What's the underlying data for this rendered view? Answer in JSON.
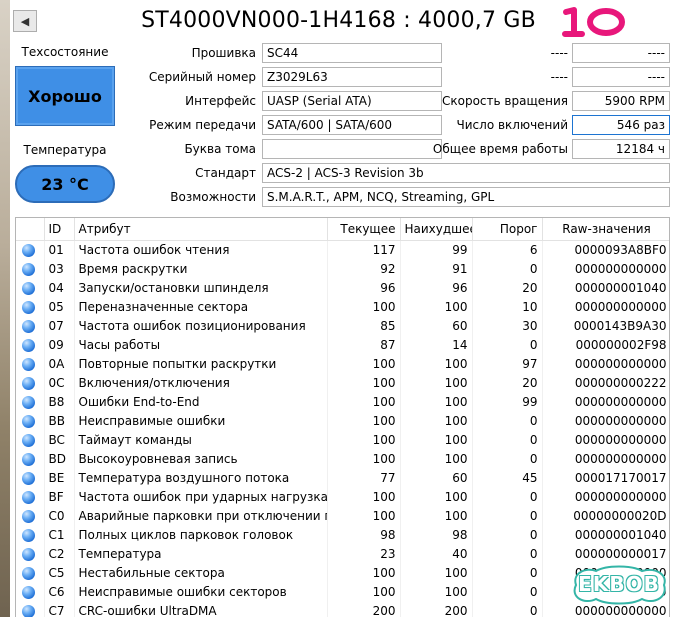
{
  "header": {
    "back_icon": "triangle-left-icon",
    "title": "ST4000VN000-1H4168 : 4000,7 GB",
    "scribble_text": "10",
    "scribble_color": "#e8177b"
  },
  "health": {
    "label": "Техсостояние",
    "status": "Хорошо",
    "color": "#3f8fe6"
  },
  "temperature": {
    "label": "Температура",
    "value": "23 °C"
  },
  "fields": {
    "firmware": {
      "label": "Прошивка",
      "value": "SC44"
    },
    "serial": {
      "label": "Серийный номер",
      "value": "Z3029L63"
    },
    "interface": {
      "label": "Интерфейс",
      "value": "UASP (Serial ATA)"
    },
    "transfer_mode": {
      "label": "Режим передачи",
      "value": "SATA/600 | SATA/600"
    },
    "drive_letter": {
      "label": "Буква тома",
      "value": ""
    },
    "standard": {
      "label": "Стандарт",
      "value": "ACS-2 | ACS-3 Revision 3b"
    },
    "features": {
      "label": "Возможности",
      "value": "S.M.A.R.T., APM, NCQ, Streaming, GPL"
    }
  },
  "right_fields": {
    "r1_label": "----",
    "r1_value": "----",
    "r2_label": "----",
    "r2_value": "----",
    "rotation": {
      "label": "Скорость вращения",
      "value": "5900 RPM"
    },
    "power_count": {
      "label": "Число включений",
      "value": "546 раз"
    },
    "power_hours": {
      "label": "Общее время работы",
      "value": "12184 ч"
    }
  },
  "table": {
    "headers": {
      "id": "ID",
      "attr": "Атрибут",
      "cur": "Текущее",
      "worst": "Наихудшее",
      "thr": "Порог",
      "raw": "Raw-значения"
    },
    "rows": [
      {
        "id": "01",
        "attr": "Частота ошибок чтения",
        "cur": "117",
        "worst": "99",
        "thr": "6",
        "raw": "0000093A8BF0"
      },
      {
        "id": "03",
        "attr": "Время раскрутки",
        "cur": "92",
        "worst": "91",
        "thr": "0",
        "raw": "000000000000"
      },
      {
        "id": "04",
        "attr": "Запуски/остановки шпинделя",
        "cur": "96",
        "worst": "96",
        "thr": "20",
        "raw": "000000001040"
      },
      {
        "id": "05",
        "attr": "Переназначенные сектора",
        "cur": "100",
        "worst": "100",
        "thr": "10",
        "raw": "000000000000"
      },
      {
        "id": "07",
        "attr": "Частота ошибок позиционирования",
        "cur": "85",
        "worst": "60",
        "thr": "30",
        "raw": "0000143B9A30"
      },
      {
        "id": "09",
        "attr": "Часы работы",
        "cur": "87",
        "worst": "14",
        "thr": "0",
        "raw": "000000002F98"
      },
      {
        "id": "0A",
        "attr": "Повторные попытки раскрутки",
        "cur": "100",
        "worst": "100",
        "thr": "97",
        "raw": "000000000000"
      },
      {
        "id": "0C",
        "attr": "Включения/отключения",
        "cur": "100",
        "worst": "100",
        "thr": "20",
        "raw": "000000000222"
      },
      {
        "id": "B8",
        "attr": "Ошибки End-to-End",
        "cur": "100",
        "worst": "100",
        "thr": "99",
        "raw": "000000000000"
      },
      {
        "id": "BB",
        "attr": "Неисправимые ошибки",
        "cur": "100",
        "worst": "100",
        "thr": "0",
        "raw": "000000000000"
      },
      {
        "id": "BC",
        "attr": "Таймаут команды",
        "cur": "100",
        "worst": "100",
        "thr": "0",
        "raw": "000000000000"
      },
      {
        "id": "BD",
        "attr": "Высокоуровневая запись",
        "cur": "100",
        "worst": "100",
        "thr": "0",
        "raw": "000000000000"
      },
      {
        "id": "BE",
        "attr": "Температура воздушного потока",
        "cur": "77",
        "worst": "60",
        "thr": "45",
        "raw": "000017170017"
      },
      {
        "id": "BF",
        "attr": "Частота ошибок при ударных нагрузках",
        "cur": "100",
        "worst": "100",
        "thr": "0",
        "raw": "000000000000"
      },
      {
        "id": "C0",
        "attr": "Аварийные парковки при отключении пи...",
        "cur": "100",
        "worst": "100",
        "thr": "0",
        "raw": "00000000020D"
      },
      {
        "id": "C1",
        "attr": "Полных циклов парковок головок",
        "cur": "98",
        "worst": "98",
        "thr": "0",
        "raw": "000000001040"
      },
      {
        "id": "C2",
        "attr": "Температура",
        "cur": "23",
        "worst": "40",
        "thr": "0",
        "raw": "000000000017"
      },
      {
        "id": "C5",
        "attr": "Нестабильные сектора",
        "cur": "100",
        "worst": "100",
        "thr": "0",
        "raw": "000000000000"
      },
      {
        "id": "C6",
        "attr": "Неисправимые ошибки секторов",
        "cur": "100",
        "worst": "100",
        "thr": "0",
        "raw": "000000000000"
      },
      {
        "id": "C7",
        "attr": "CRC-ошибки UltraDMA",
        "cur": "200",
        "worst": "200",
        "thr": "0",
        "raw": "000000000000"
      }
    ],
    "status_icon": "blue-circle-icon"
  },
  "watermark": {
    "text": "EKBOB",
    "color": "#34b5a7"
  }
}
